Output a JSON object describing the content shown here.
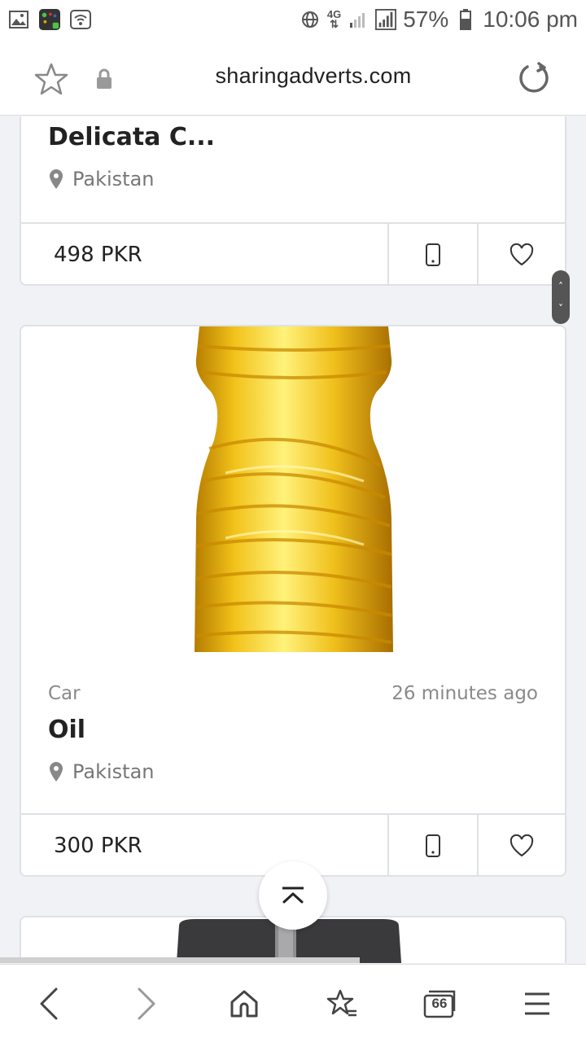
{
  "status_bar": {
    "network": "4G",
    "battery": "57%",
    "time": "10:06 pm"
  },
  "browser": {
    "url": "sharingadverts.com",
    "tab_count": "66"
  },
  "listings": [
    {
      "title": "Delicata C...",
      "location": "Pakistan",
      "price": "498 PKR"
    },
    {
      "category": "Car",
      "posted": "26 minutes ago",
      "title": "Oil",
      "location": "Pakistan",
      "price": "300 PKR"
    }
  ],
  "colors": {
    "accent": "#f1f2f6",
    "border": "#dfe1e6",
    "muted": "#8a8a8a"
  }
}
